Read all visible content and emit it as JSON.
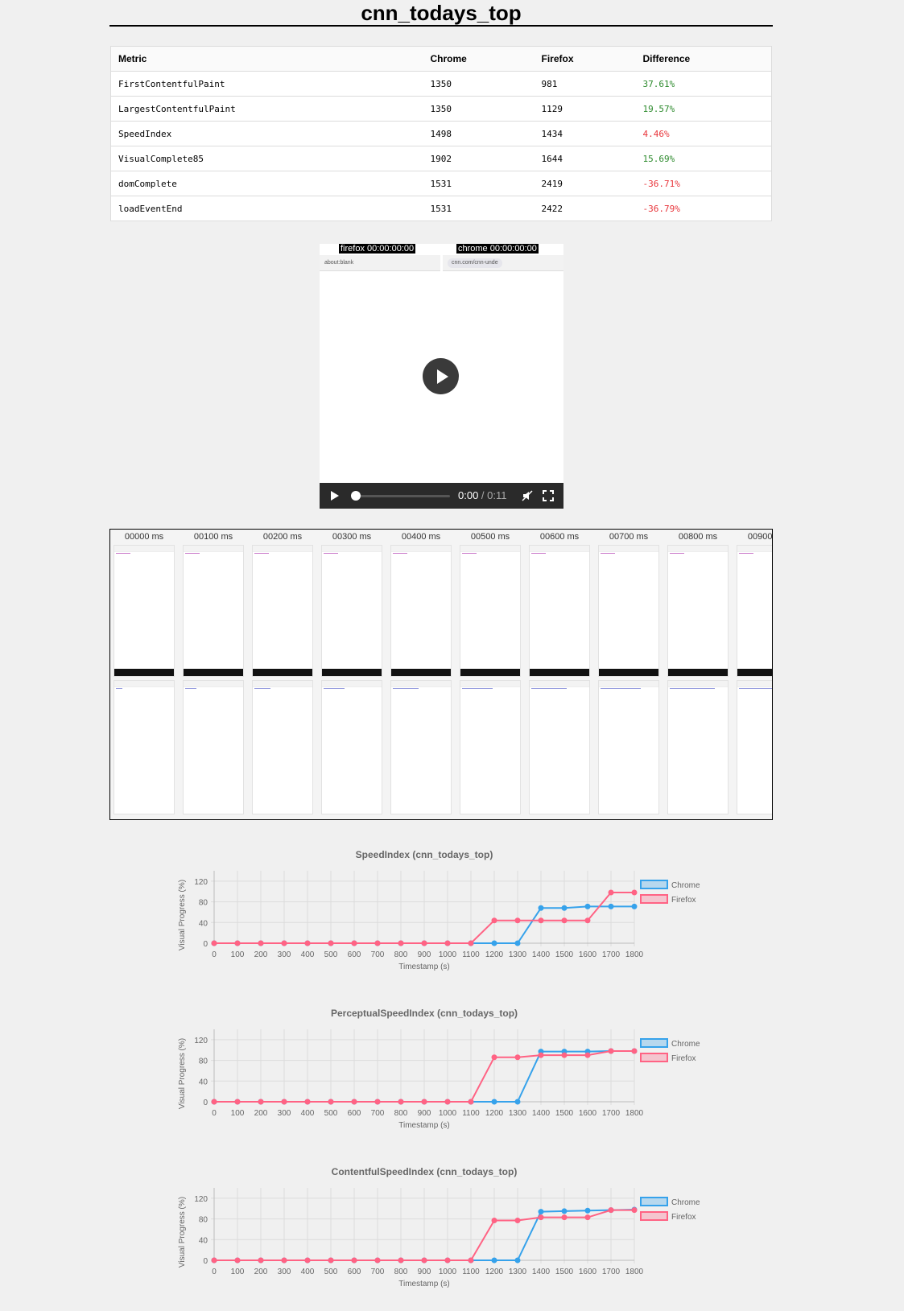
{
  "page": {
    "title": "cnn_todays_top"
  },
  "table": {
    "headers": [
      "Metric",
      "Chrome",
      "Firefox",
      "Difference"
    ],
    "rows": [
      {
        "metric": "FirstContentfulPaint",
        "chrome": "1350",
        "firefox": "981",
        "diff": "37.61%",
        "tone": "pos"
      },
      {
        "metric": "LargestContentfulPaint",
        "chrome": "1350",
        "firefox": "1129",
        "diff": "19.57%",
        "tone": "pos"
      },
      {
        "metric": "SpeedIndex",
        "chrome": "1498",
        "firefox": "1434",
        "diff": "4.46%",
        "tone": "neg"
      },
      {
        "metric": "VisualComplete85",
        "chrome": "1902",
        "firefox": "1644",
        "diff": "15.69%",
        "tone": "pos"
      },
      {
        "metric": "domComplete",
        "chrome": "1531",
        "firefox": "2419",
        "diff": "-36.71%",
        "tone": "neg"
      },
      {
        "metric": "loadEventEnd",
        "chrome": "1531",
        "firefox": "2422",
        "diff": "-36.79%",
        "tone": "neg"
      }
    ]
  },
  "video": {
    "firefox_caption": "firefox 00:00:00:00",
    "chrome_caption": "chrome 00:00:00:00",
    "firefox_url": "about:blank",
    "chrome_url": "cnn.com/cnn-unde",
    "time_current": "0:00",
    "time_separator": " / ",
    "time_duration": "0:11"
  },
  "filmstrip": {
    "labels": [
      "00000 ms",
      "00100 ms",
      "00200 ms",
      "00300 ms",
      "00400 ms",
      "00500 ms",
      "00600 ms",
      "00700 ms",
      "00800 ms",
      "00900 ms"
    ]
  },
  "colors": {
    "chrome": "#36a2eb",
    "firefox": "#ff6384"
  },
  "chart_data": [
    {
      "type": "line",
      "title": "SpeedIndex (cnn_todays_top)",
      "xlabel": "Timestamp (s)",
      "ylabel": "Visual Progress (%)",
      "x": [
        0,
        100,
        200,
        300,
        400,
        500,
        600,
        700,
        800,
        900,
        1000,
        1100,
        1200,
        1300,
        1400,
        1500,
        1600,
        1700,
        1800
      ],
      "ylim": [
        0,
        140
      ],
      "yticks": [
        0,
        40,
        80,
        120
      ],
      "legend": "right",
      "series": [
        {
          "name": "Chrome",
          "values": [
            0,
            0,
            0,
            0,
            0,
            0,
            0,
            0,
            0,
            0,
            0,
            0,
            0,
            0,
            68,
            68,
            71,
            71,
            71
          ]
        },
        {
          "name": "Firefox",
          "values": [
            0,
            0,
            0,
            0,
            0,
            0,
            0,
            0,
            0,
            0,
            0,
            0,
            44,
            44,
            44,
            44,
            44,
            98,
            98
          ]
        }
      ]
    },
    {
      "type": "line",
      "title": "PerceptualSpeedIndex (cnn_todays_top)",
      "xlabel": "Timestamp (s)",
      "ylabel": "Visual Progress (%)",
      "x": [
        0,
        100,
        200,
        300,
        400,
        500,
        600,
        700,
        800,
        900,
        1000,
        1100,
        1200,
        1300,
        1400,
        1500,
        1600,
        1700,
        1800
      ],
      "ylim": [
        0,
        140
      ],
      "yticks": [
        0,
        40,
        80,
        120
      ],
      "legend": "right",
      "series": [
        {
          "name": "Chrome",
          "values": [
            0,
            0,
            0,
            0,
            0,
            0,
            0,
            0,
            0,
            0,
            0,
            0,
            0,
            0,
            97,
            97,
            97,
            98,
            98
          ]
        },
        {
          "name": "Firefox",
          "values": [
            0,
            0,
            0,
            0,
            0,
            0,
            0,
            0,
            0,
            0,
            0,
            0,
            86,
            86,
            90,
            90,
            90,
            98,
            98
          ]
        }
      ]
    },
    {
      "type": "line",
      "title": "ContentfulSpeedIndex (cnn_todays_top)",
      "xlabel": "Timestamp (s)",
      "ylabel": "Visual Progress (%)",
      "x": [
        0,
        100,
        200,
        300,
        400,
        500,
        600,
        700,
        800,
        900,
        1000,
        1100,
        1200,
        1300,
        1400,
        1500,
        1600,
        1700,
        1800
      ],
      "ylim": [
        0,
        140
      ],
      "yticks": [
        0,
        40,
        80,
        120
      ],
      "legend": "right",
      "series": [
        {
          "name": "Chrome",
          "values": [
            0,
            0,
            0,
            0,
            0,
            0,
            0,
            0,
            0,
            0,
            0,
            0,
            0,
            0,
            94,
            95,
            96,
            97,
            98
          ]
        },
        {
          "name": "Firefox",
          "values": [
            0,
            0,
            0,
            0,
            0,
            0,
            0,
            0,
            0,
            0,
            0,
            0,
            77,
            77,
            83,
            83,
            83,
            97,
            97
          ]
        }
      ]
    }
  ]
}
